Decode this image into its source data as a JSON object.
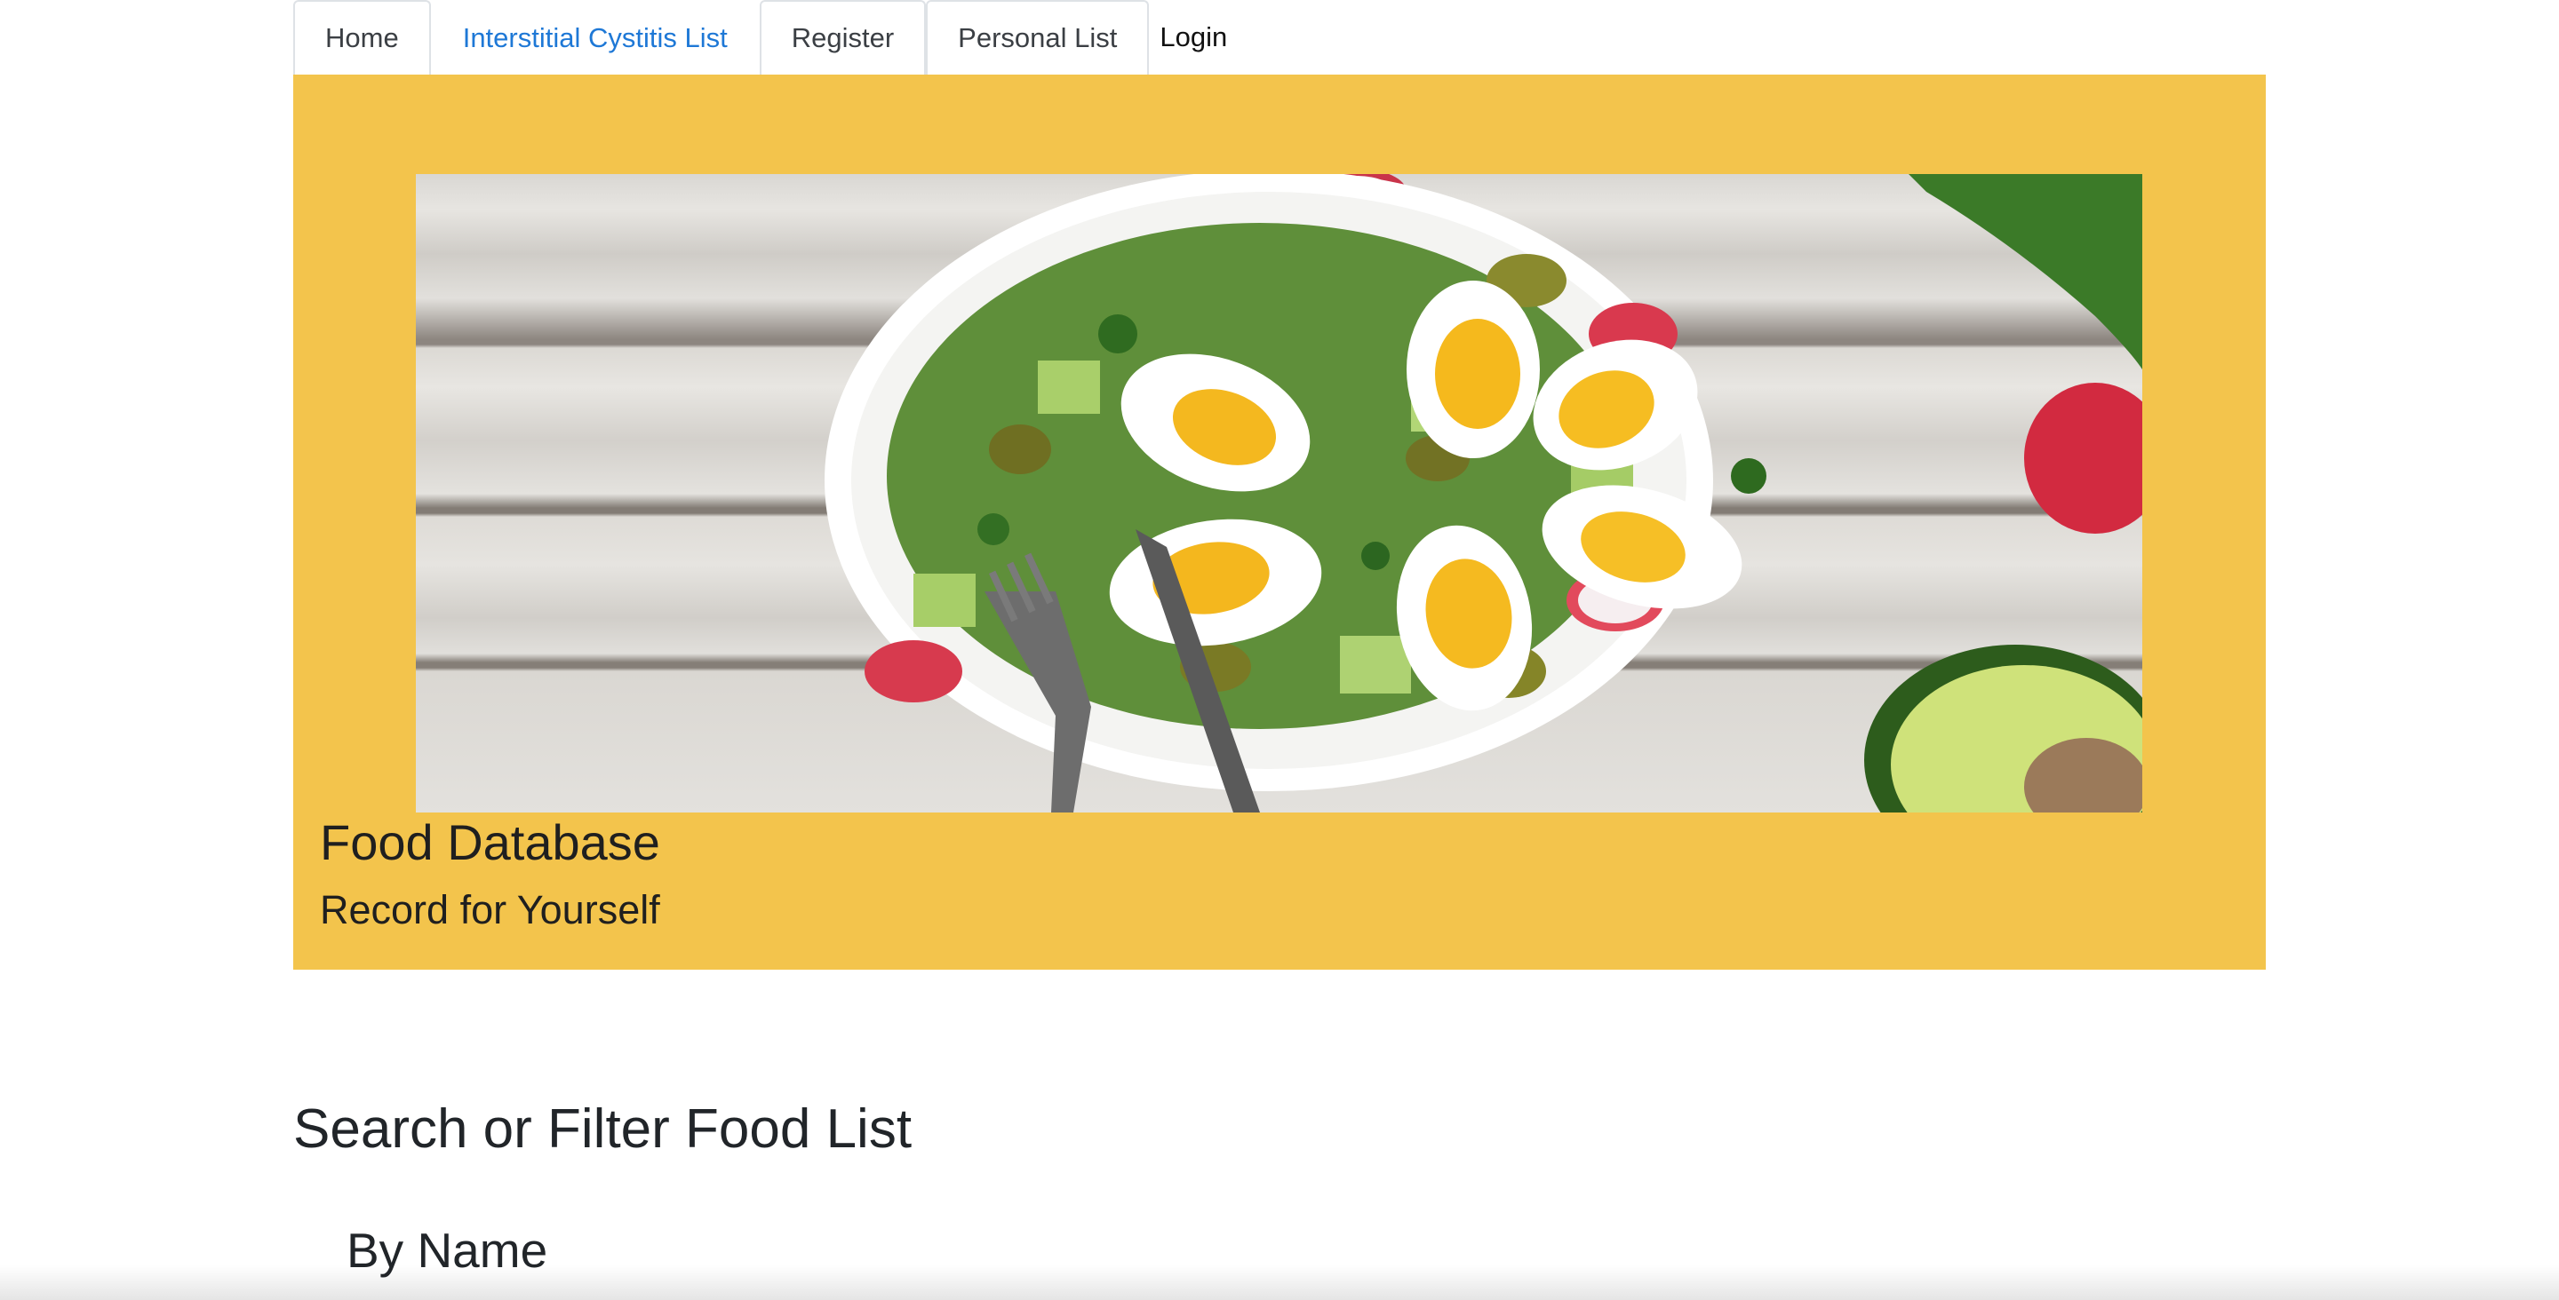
{
  "nav": {
    "tabs": [
      {
        "label": "Home"
      },
      {
        "label": "Interstitial Cystitis List"
      },
      {
        "label": "Register"
      },
      {
        "label": "Personal List"
      },
      {
        "label": "Login"
      }
    ],
    "active_tab": "Interstitial Cystitis List"
  },
  "hero": {
    "title": "Food Database",
    "subtitle": "Record for Yourself",
    "image": "salad-with-eggs-photo",
    "background_color": "#f3c44c"
  },
  "search": {
    "title": "Search or Filter Food List",
    "by_name_label": "By Name"
  },
  "colors": {
    "link_active": "#1e78d6",
    "text": "#212529"
  }
}
